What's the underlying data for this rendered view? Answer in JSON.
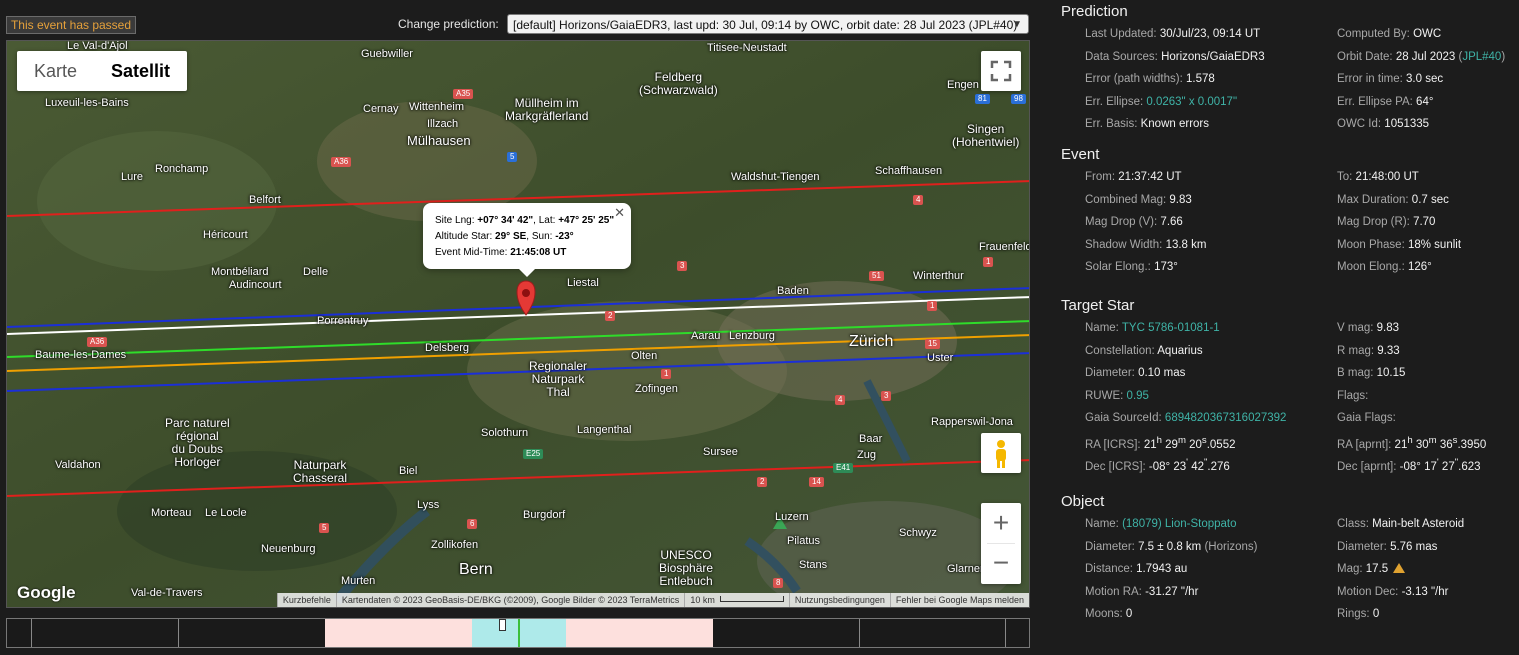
{
  "top": {
    "passed_badge": "This event has passed",
    "change_label": "Change prediction:",
    "prediction_select": "[default] Horizons/GaiaEDR3, last upd: 30 Jul, 09:14 by OWC, orbit date: 28 Jul 2023 (JPL#40)"
  },
  "map": {
    "type_map": "Karte",
    "type_satellite": "Satellit",
    "google": "Google",
    "popup": {
      "site_lng_label": "Site Lng:",
      "site_lng": "+07° 34' 42\"",
      "lat_label": "Lat:",
      "lat": "+47° 25' 25\"",
      "alt_label": "Altitude Star:",
      "alt": "29° SE",
      "sun_label": "Sun:",
      "sun": "-23°",
      "mid_label": "Event Mid-Time:",
      "mid": "21:45:08 UT"
    },
    "attribution": {
      "shortcuts": "Kurzbefehle",
      "data": "Kartendaten © 2023 GeoBasis-DE/BKG (©2009), Google Bilder © 2023 TerraMetrics",
      "scale": "10 km",
      "terms": "Nutzungsbedingungen",
      "report": "Fehler bei Google Maps melden"
    },
    "towns": {
      "valdajol": "Le Val-d'Ajol",
      "guebwiller": "Guebwiller",
      "titisee": "Titisee-Neustadt",
      "feldberg": "Feldberg\n(Schwarzwald)",
      "engen": "Engen",
      "luxeuil": "Luxeuil-les-Bains",
      "cernay": "Cernay",
      "wittenheim": "Wittenheim",
      "illzach": "Illzach",
      "mulhausen": "Mülhausen",
      "mullheim": "Müllheim im\nMarkgräflerland",
      "singen": "Singen\n(Hohentwiel)",
      "ronchamp": "Ronchamp",
      "lure": "Lure",
      "schaffhausen": "Schaffhausen",
      "belfort": "Belfort",
      "waldshut": "Waldshut-Tiengen",
      "frauenfeld": "Frauenfeld",
      "hericourt": "Héricourt",
      "montbeliard": "Montbéliard",
      "audincourt": "Audincourt",
      "delle": "Delle",
      "winterthur": "Winterthur",
      "liestal": "Liestal",
      "baden": "Baden",
      "porrentruy": "Porrentruy",
      "baume": "Baume-les-Dames",
      "aarau": "Aarau",
      "lenzburg": "Lenzburg",
      "zurich": "Zürich",
      "delsberg": "Delsberg",
      "olten": "Olten",
      "uster": "Uster",
      "regionaler": "Regionaler\nNaturpark\nThal",
      "zofingen": "Zofingen",
      "parc": "Parc naturel\nrégional\ndu Doubs\nHorloger",
      "rapperswil": "Rapperswil-Jona",
      "solothurn": "Solothurn",
      "langenthal": "Langenthal",
      "baar": "Baar",
      "sursee": "Sursee",
      "zug": "Zug",
      "valdahon": "Valdahon",
      "chasseral": "Naturpark\nChasseral",
      "biel": "Biel",
      "morteau": "Morteau",
      "lelocle": "Le Locle",
      "lyss": "Lyss",
      "burgdorf": "Burgdorf",
      "luzern": "Luzern",
      "pilatus": "Pilatus",
      "schwyz": "Schwyz",
      "neuenburg": "Neuenburg",
      "zollikofen": "Zollikofen",
      "unesco": "UNESCO\nBiosphäre\nEntlebuch",
      "bern": "Bern",
      "murten": "Murten",
      "valdetravers": "Val-de-Travers",
      "stans": "Stans",
      "glarner": "Glarner Al"
    },
    "shields": {
      "a35": "A35",
      "a36a": "A36",
      "a36b": "A36",
      "r5": "5",
      "r4": "4",
      "r3": "3",
      "r51": "51",
      "r1a": "1",
      "r1b": "1",
      "r2": "2",
      "r15": "15",
      "r1c": "1",
      "r4b": "4",
      "r3b": "3",
      "e25": "E25",
      "e41": "E41",
      "r2b": "2",
      "r14": "14",
      "r6": "6",
      "r5b": "5",
      "r8": "8",
      "r81": "81",
      "r98": "98"
    }
  },
  "panel": {
    "prediction": {
      "title": "Prediction",
      "last_updated_label": "Last Updated:",
      "last_updated": "30/Jul/23, 09:14 UT",
      "computed_by_label": "Computed By:",
      "computed_by": "OWC",
      "sources_label": "Data Sources:",
      "sources": "Horizons/GaiaEDR3",
      "orbit_label": "Orbit Date:",
      "orbit": "28 Jul 2023",
      "orbit_jpl": "JPL#40",
      "err_path_label": "Error (path widths):",
      "err_path": "1.578",
      "err_time_label": "Error in time:",
      "err_time": "3.0 sec",
      "ellipse_label": "Err. Ellipse:",
      "ellipse": "0.0263\" x 0.0017\"",
      "ellipse_pa_label": "Err. Ellipse PA:",
      "ellipse_pa": "64°",
      "basis_label": "Err. Basis:",
      "basis": "Known errors",
      "owc_label": "OWC Id:",
      "owc": "1051335"
    },
    "event": {
      "title": "Event",
      "from_label": "From:",
      "from": "21:37:42 UT",
      "to_label": "To:",
      "to": "21:48:00 UT",
      "cmag_label": "Combined Mag:",
      "cmag": "9.83",
      "maxdur_label": "Max Duration:",
      "maxdur": "0.7 sec",
      "dropv_label": "Mag Drop (V):",
      "dropv": "7.66",
      "dropr_label": "Mag Drop (R):",
      "dropr": "7.70",
      "shadow_label": "Shadow Width:",
      "shadow": "13.8 km",
      "moonph_label": "Moon Phase:",
      "moonph": "18% sunlit",
      "solar_label": "Solar Elong.:",
      "solar": "173°",
      "moonel_label": "Moon Elong.:",
      "moonel": "126°"
    },
    "star": {
      "title": "Target Star",
      "name_label": "Name:",
      "name": "TYC 5786-01081-1",
      "vmag_label": "V mag:",
      "vmag": "9.83",
      "const_label": "Constellation:",
      "const": "Aquarius",
      "rmag_label": "R mag:",
      "rmag": "9.33",
      "diam_label": "Diameter:",
      "diam": "0.10 mas",
      "bmag_label": "B mag:",
      "bmag": "10.15",
      "ruwe_label": "RUWE:",
      "ruwe": "0.95",
      "flags_label": "Flags:",
      "gaia_label": "Gaia SourceId:",
      "gaia": "6894820367316027392",
      "gaiaflags_label": "Gaia Flags:",
      "ra_label": "RA [ICRS]:",
      "ra_h": "21",
      "ra_m": "29",
      "ra_s": "20",
      "ra_frac": ".0552",
      "raa_label": "RA [aprnt]:",
      "raa_h": "21",
      "raa_m": "30",
      "raa_s": "36",
      "raa_frac": ".3950",
      "dec_label": "Dec [ICRS]:",
      "dec_d": "-08° 23",
      "dec_m": "42",
      "dec_frac": ".276",
      "deca_label": "Dec [aprnt]:",
      "deca_d": "-08° 17",
      "deca_m": "27",
      "deca_frac": ".623"
    },
    "object": {
      "title": "Object",
      "name_label": "Name:",
      "name": "(18079) Lion-Stoppato",
      "class_label": "Class:",
      "class": "Main-belt Asteroid",
      "diam_label": "Diameter:",
      "diam": "7.5 ± 0.8 km",
      "diam_src": "(Horizons)",
      "diam2_label": "Diameter:",
      "diam2": "5.76 mas",
      "dist_label": "Distance:",
      "dist": "1.7943 au",
      "mag_label": "Mag:",
      "mag": "17.5",
      "mra_label": "Motion RA:",
      "mra": "-31.27 \"/hr",
      "mdec_label": "Motion Dec:",
      "mdec": "-3.13 \"/hr",
      "moons_label": "Moons:",
      "moons": "0",
      "rings_label": "Rings:",
      "rings": "0"
    }
  }
}
